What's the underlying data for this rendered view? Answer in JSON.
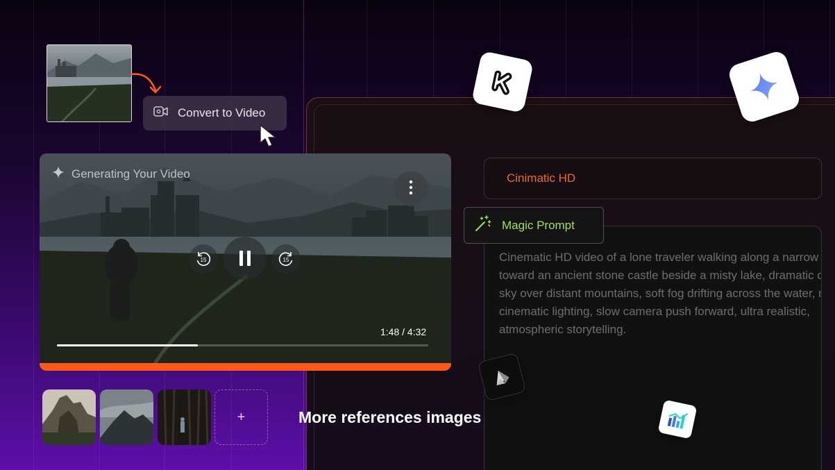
{
  "convert": {
    "label": "Convert to Video",
    "icon": "video-sparkle-icon"
  },
  "player": {
    "status_label": "Generating Your Video",
    "status_icon": "sparkle-icon",
    "time": "1:48 / 4:32",
    "progress": 0.38,
    "rewind_label": "15",
    "forward_label": "15",
    "accent_color": "#ff5a14"
  },
  "references": {
    "caption": "More references images",
    "add_label": "+"
  },
  "form": {
    "style_value": "Cinimatic HD",
    "magic_label": "Magic Prompt",
    "magic_icon": "magic-wand-icon",
    "prompt": "Cinematic HD video of a lone traveler walking along a narrow path toward an ancient stone castle beside a misty lake, dramatic cloudy sky over distant mountains, soft fog drifting across the water, moody cinematic lighting, slow camera push forward, ultra realistic, atmospheric storytelling."
  },
  "colors": {
    "orange": "#ee6a2c",
    "green": "#9be35a"
  }
}
